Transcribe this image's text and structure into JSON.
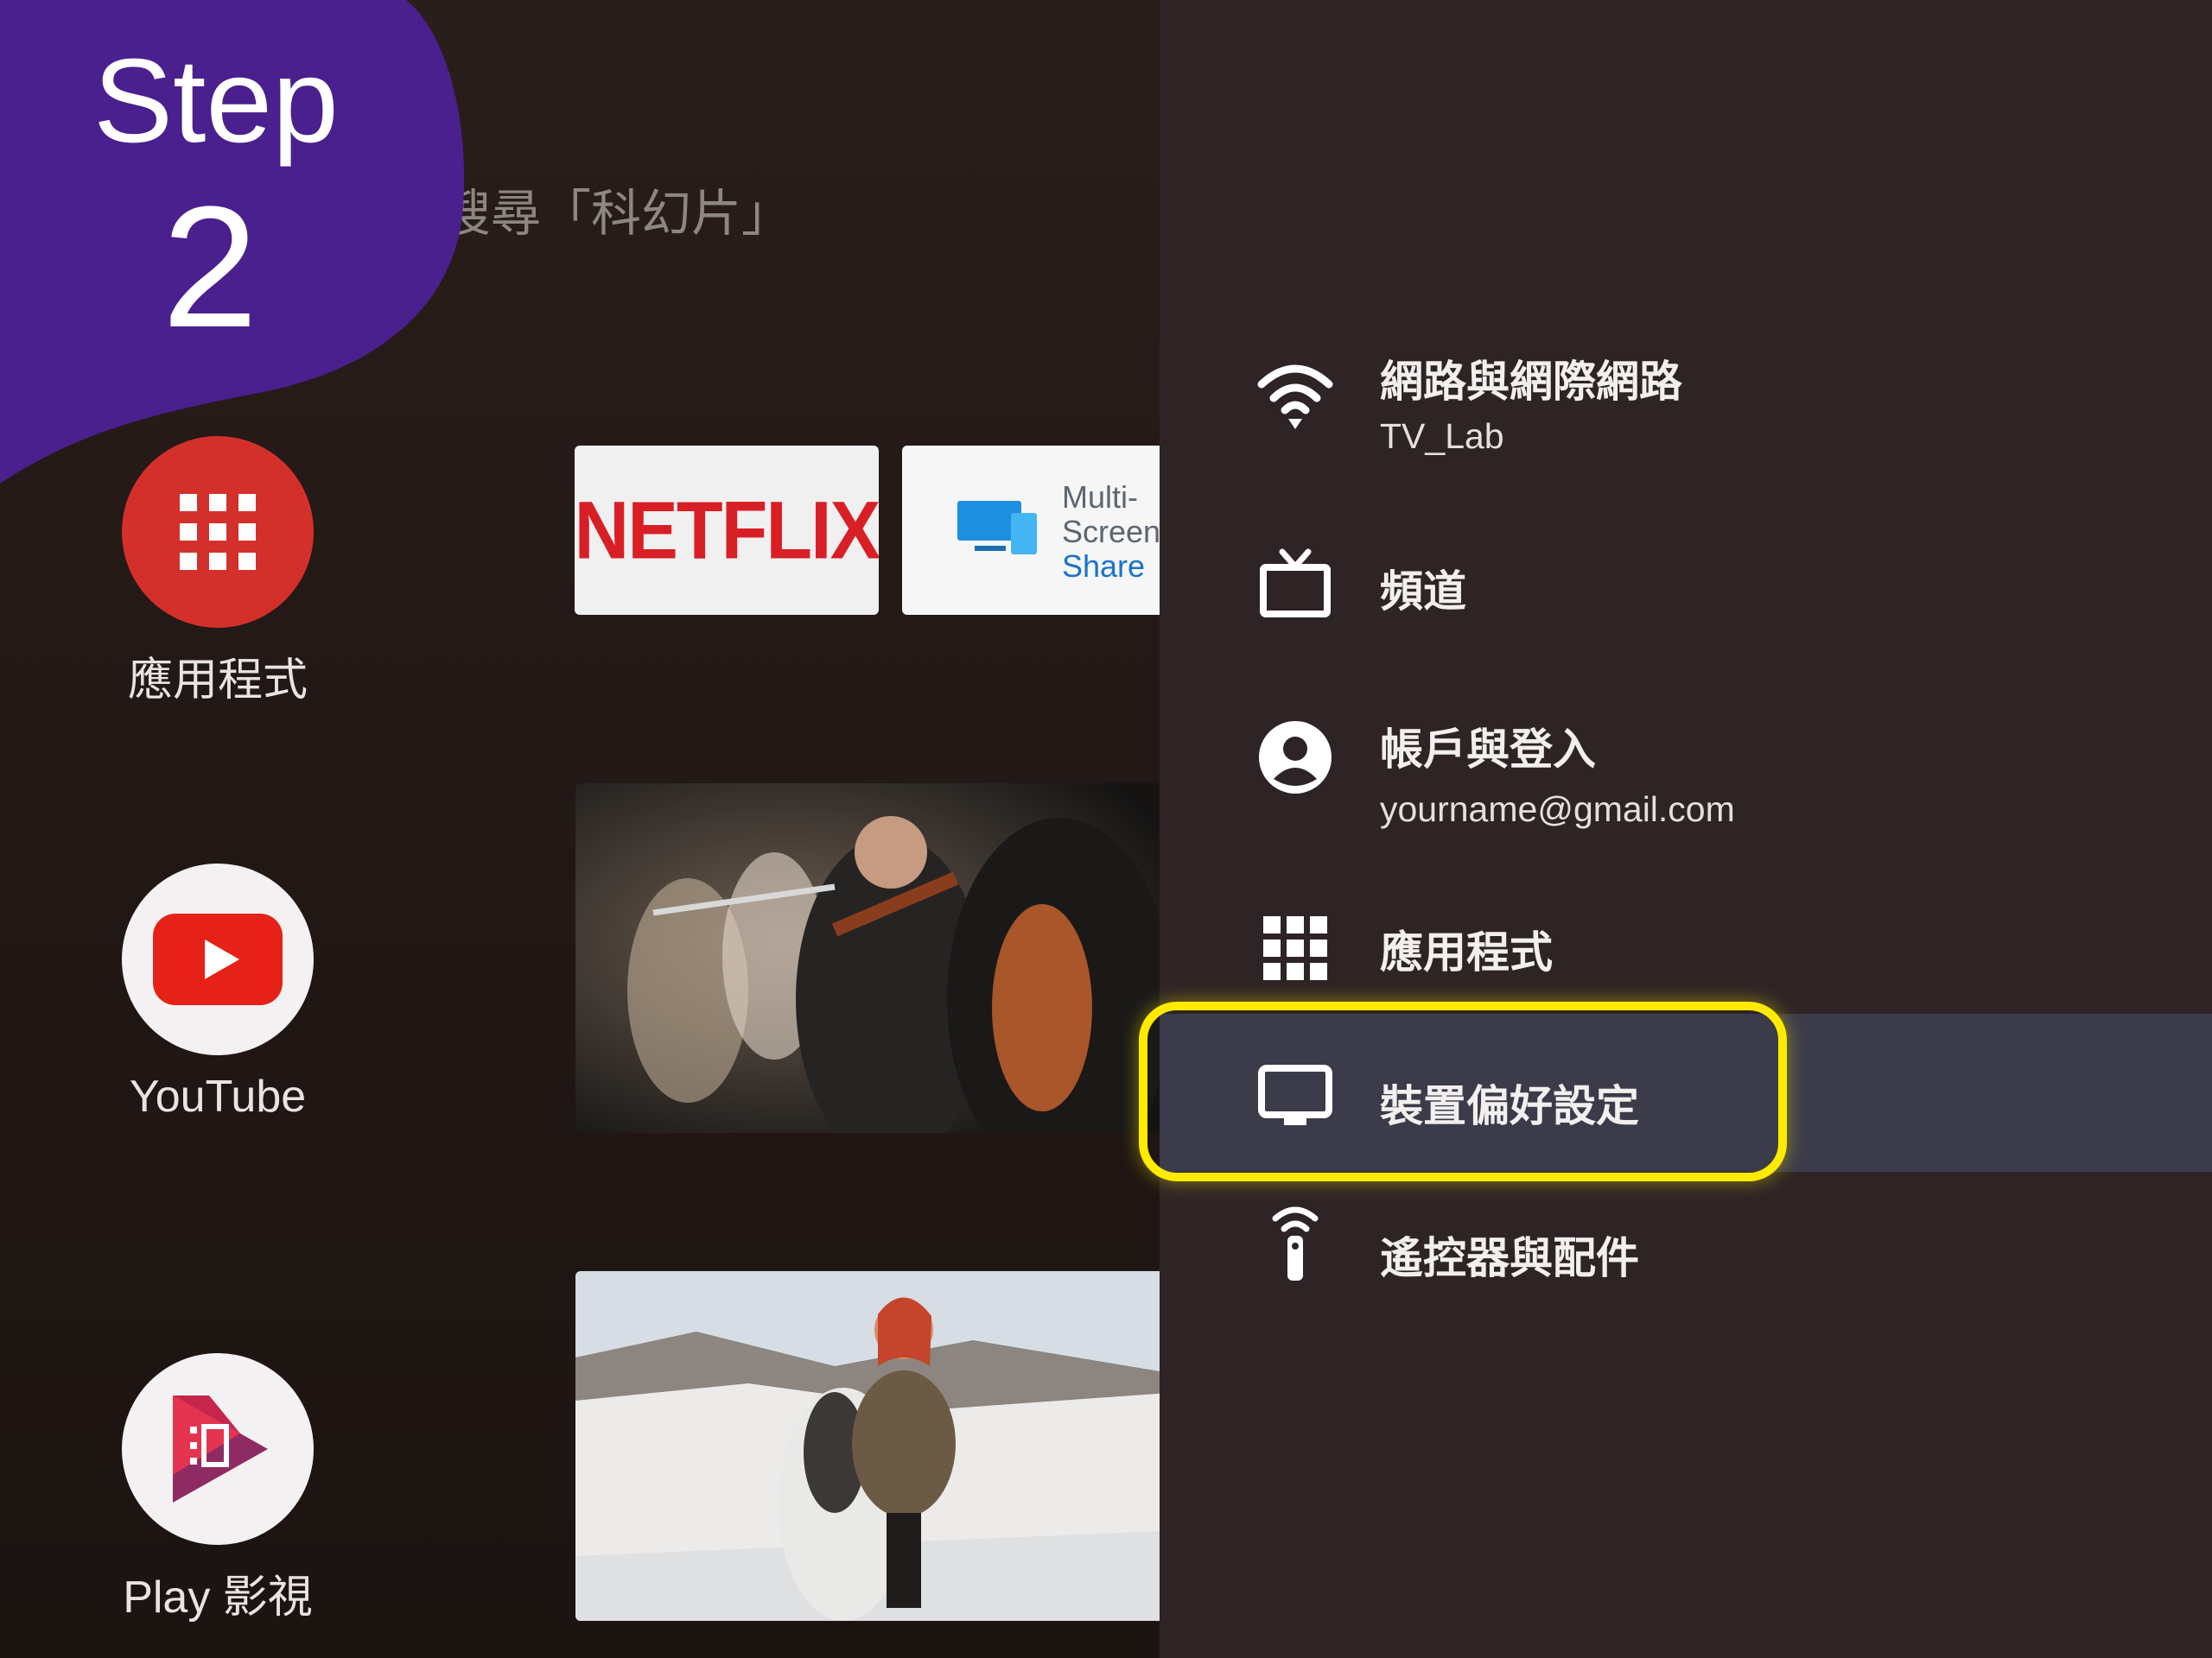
{
  "step": {
    "word": "Step",
    "number": "2"
  },
  "home": {
    "search_hint": "搜尋「科幻片」",
    "apps": [
      {
        "label": "應用程式",
        "icon": "apps-grid-icon"
      },
      {
        "label": "YouTube",
        "icon": "youtube-icon"
      },
      {
        "label": "Play 影視",
        "icon": "play-movies-icon"
      }
    ],
    "tiles": {
      "netflix": "NETFLIX",
      "mss": {
        "line1": "Multi-",
        "line2": "Screen",
        "line3": "Share"
      }
    }
  },
  "settings": {
    "items": [
      {
        "title": "網路與網際網路",
        "subtitle": "TV_Lab",
        "icon": "wifi-icon"
      },
      {
        "title": "頻道",
        "icon": "tv-icon"
      },
      {
        "title": "帳戶與登入",
        "subtitle": "yourname@gmail.com",
        "icon": "account-icon"
      },
      {
        "title": "應用程式",
        "icon": "apps-grid-icon"
      },
      {
        "title": "裝置偏好設定",
        "icon": "monitor-icon",
        "selected": true
      },
      {
        "title": "遙控器與配件",
        "icon": "remote-icon"
      }
    ]
  },
  "colors": {
    "step_bg": "#4a1f8e",
    "highlight": "#ffea00",
    "panel_bg": "#2e2425",
    "selected_row": "#3b3b4a"
  }
}
